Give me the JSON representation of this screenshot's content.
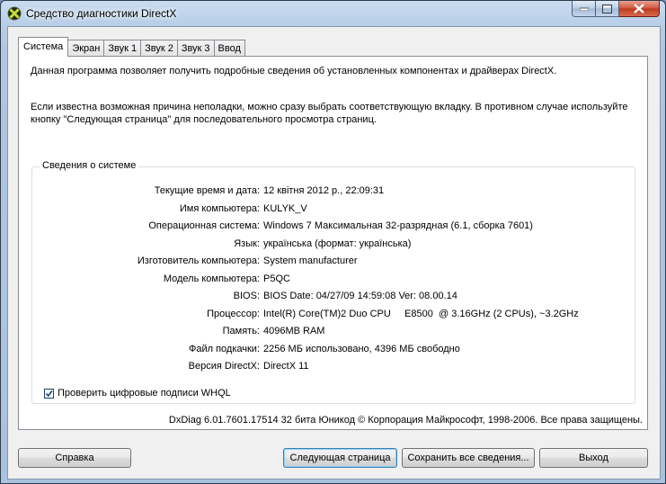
{
  "window": {
    "title": "Средство диагностики DirectX"
  },
  "tabs": [
    {
      "label": "Система",
      "active": true
    },
    {
      "label": "Экран",
      "active": false
    },
    {
      "label": "Звук 1",
      "active": false
    },
    {
      "label": "Звук 2",
      "active": false
    },
    {
      "label": "Звук 3",
      "active": false
    },
    {
      "label": "Ввод",
      "active": false
    }
  ],
  "intro": {
    "line1": "Данная программа позволяет получить подробные сведения об установленных компонентах и драйверах DirectX.",
    "line2": "Если известна возможная причина неполадки, можно сразу выбрать соответствующую вкладку. В противном случае используйте кнопку \"Следующая страница\" для последовательного просмотра страниц."
  },
  "system_info": {
    "title": "Сведения о системе",
    "rows": [
      {
        "label": "Текущие время и дата:",
        "value": "12 квітня 2012 р., 22:09:31"
      },
      {
        "label": "Имя компьютера:",
        "value": "KULYK_V"
      },
      {
        "label": "Операционная система:",
        "value": "Windows 7 Максимальная 32-разрядная (6.1, сборка 7601)"
      },
      {
        "label": "Язык:",
        "value": "українська (формат: українська)"
      },
      {
        "label": "Изготовитель компьютера:",
        "value": "System manufacturer"
      },
      {
        "label": "Модель компьютера:",
        "value": "P5QC"
      },
      {
        "label": "BIOS:",
        "value": "BIOS Date: 04/27/09 14:59:08 Ver: 08.00.14"
      },
      {
        "label": "Процессор:",
        "value": "Intel(R) Core(TM)2 Duo CPU     E8500  @ 3.16GHz (2 CPUs), ~3.2GHz"
      },
      {
        "label": "Память:",
        "value": "4096MB RAM"
      },
      {
        "label": "Файл подкачки:",
        "value": "2256 МБ использовано, 4396 МБ свободно"
      },
      {
        "label": "Версия DirectX:",
        "value": "DirectX 11"
      }
    ]
  },
  "whql": {
    "label": "Проверить цифровые подписи WHQL",
    "checked": true
  },
  "footer": "DxDiag 6.01.7601.17514 32 бита Юникод  © Корпорация Майкрософт, 1998-2006.  Все права защищены.",
  "buttons": {
    "help": "Справка",
    "next": "Следующая страница",
    "save": "Сохранить все сведения...",
    "exit": "Выход"
  }
}
